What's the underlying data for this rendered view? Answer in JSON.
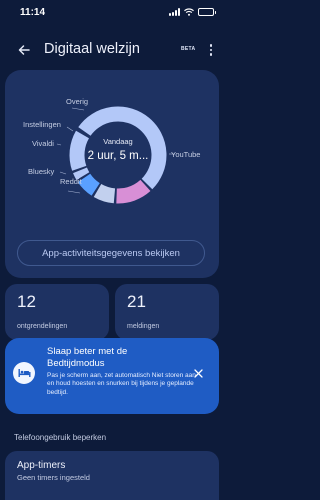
{
  "status_bar": {
    "time": "11:14"
  },
  "header": {
    "title": "Digitaal welzijn",
    "badge": "BETA"
  },
  "overview": {
    "center_caption": "Vandaag",
    "center_value": "2 uur, 5 m...",
    "activity_button": "App-activiteitsgegevens bekijken",
    "segments": [
      {
        "label": "YouTube",
        "color": "#b3c8f8"
      },
      {
        "label": "Reddit",
        "color": "#d88fd6"
      },
      {
        "label": "Bluesky",
        "color": "#c2d0ee"
      },
      {
        "label": "Vivaldi",
        "color": "#5aa0ff"
      },
      {
        "label": "Instellingen",
        "color": "#b3c8f8"
      },
      {
        "label": "Overig",
        "color": "#b3c8f8"
      }
    ]
  },
  "stats": {
    "unlocks": {
      "value": "12",
      "label": "ontgrendelingen"
    },
    "notifications": {
      "value": "21",
      "label": "meldingen"
    }
  },
  "sleep_card": {
    "title": "Slaap beter met de Bedtijdmodus",
    "description": "Pas je scherm aan, zet automatisch Niet storen aan en houd hoesten en snurken bij tijdens je geplande bedtijd."
  },
  "limits": {
    "section_title": "Telefoongebruik beperken",
    "app_timers": {
      "title": "App-timers",
      "subtitle": "Geen timers ingesteld"
    }
  }
}
